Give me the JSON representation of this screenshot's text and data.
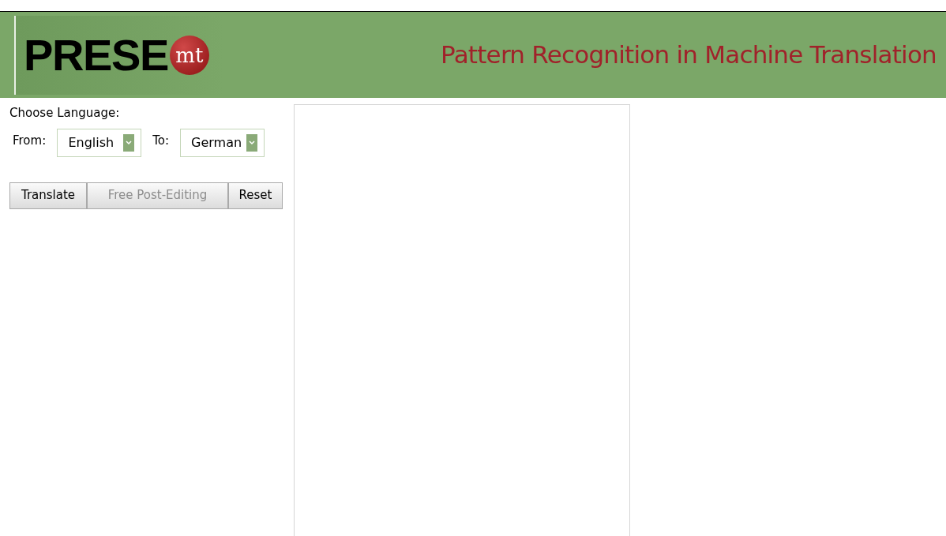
{
  "header": {
    "logo_text": "PRESE",
    "logo_badge": "mt",
    "tagline": "Pattern Recognition in Machine Translation"
  },
  "language": {
    "title": "Choose Language:",
    "from_label": "From:",
    "from_value": "English",
    "to_label": "To:",
    "to_value": "German"
  },
  "buttons": [
    {
      "label": "Translate",
      "disabled": false
    },
    {
      "label": "Free Post-Editing",
      "disabled": true
    },
    {
      "label": "Reset",
      "disabled": false
    }
  ]
}
